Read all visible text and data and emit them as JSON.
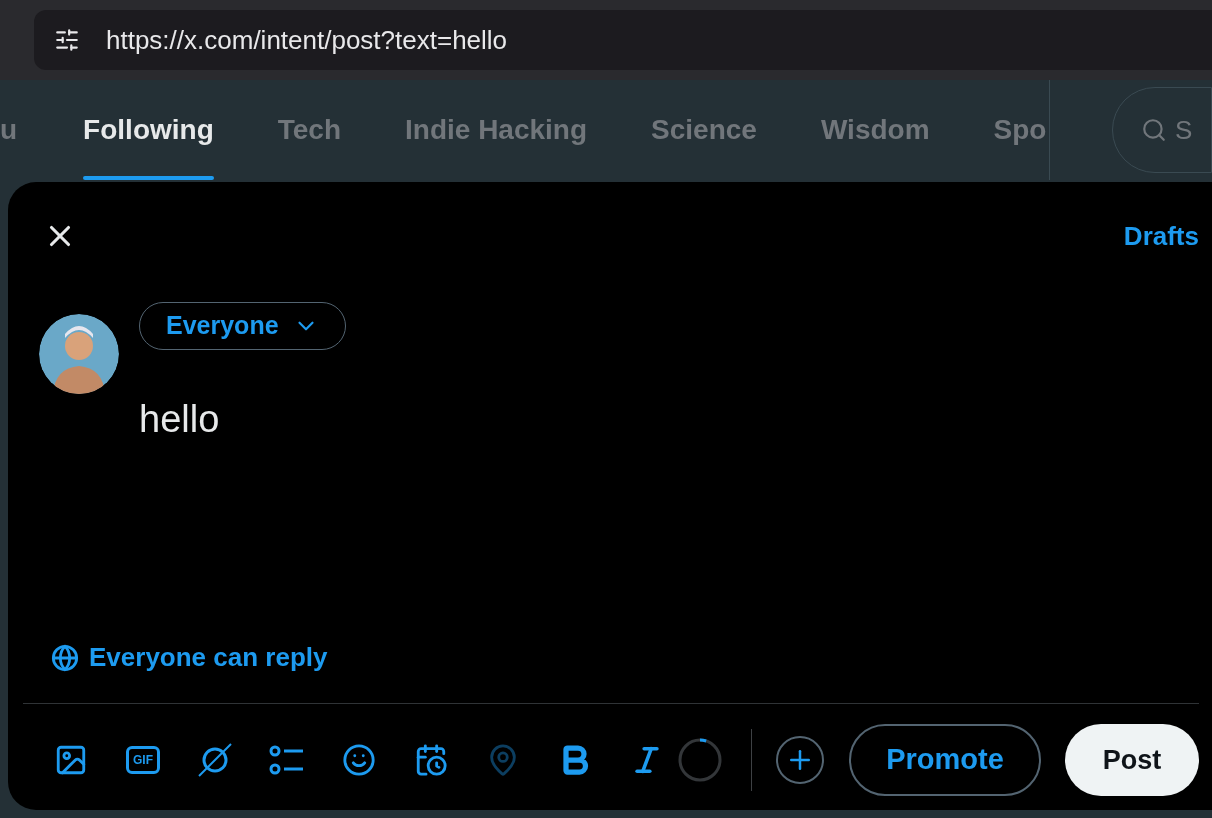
{
  "browser": {
    "url": "https://x.com/intent/post?text=hello"
  },
  "tabs": [
    {
      "label": "u",
      "selected": false
    },
    {
      "label": "Following",
      "selected": true
    },
    {
      "label": "Tech",
      "selected": false
    },
    {
      "label": "Indie Hacking",
      "selected": false
    },
    {
      "label": "Science",
      "selected": false
    },
    {
      "label": "Wisdom",
      "selected": false
    },
    {
      "label": "Spo",
      "selected": false
    }
  ],
  "search": {
    "placeholder": "S"
  },
  "composer": {
    "drafts": "Drafts",
    "audience": "Everyone",
    "text": "hello",
    "reply_setting": "Everyone can reply",
    "toolbar": [
      {
        "kind": "image",
        "disabled": false
      },
      {
        "kind": "gif",
        "label": "GIF",
        "disabled": false
      },
      {
        "kind": "grok",
        "disabled": false
      },
      {
        "kind": "poll",
        "disabled": false
      },
      {
        "kind": "emoji",
        "disabled": false
      },
      {
        "kind": "schedule",
        "disabled": false
      },
      {
        "kind": "location",
        "disabled": true
      },
      {
        "kind": "bold",
        "disabled": false
      },
      {
        "kind": "italic",
        "disabled": false
      }
    ],
    "counter": {
      "level": 0.05
    },
    "promote": "Promote",
    "post": "Post"
  }
}
